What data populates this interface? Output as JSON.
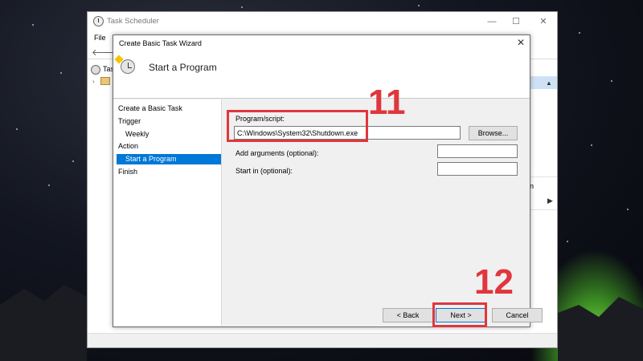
{
  "main_window": {
    "title": "Task Scheduler",
    "menu_file": "File",
    "tree_label": "Tasl",
    "right_pane_fragment": "n",
    "minimize_glyph": "—",
    "maximize_glyph": "☐",
    "close_glyph": "✕"
  },
  "dialog": {
    "title": "Create Basic Task Wizard",
    "header_title": "Start a Program",
    "close_glyph": "✕",
    "nav": [
      {
        "label": "Create a Basic Task"
      },
      {
        "label": "Trigger"
      },
      {
        "label": "Weekly"
      },
      {
        "label": "Action"
      },
      {
        "label": "Start a Program"
      },
      {
        "label": "Finish"
      }
    ],
    "form": {
      "program_label": "Program/script:",
      "program_value": "C:\\Windows\\System32\\Shutdown.exe",
      "browse_label": "Browse...",
      "args_label": "Add arguments (optional):",
      "args_value": "",
      "startin_label": "Start in (optional):",
      "startin_value": ""
    },
    "buttons": {
      "back": "< Back",
      "next": "Next >",
      "cancel": "Cancel"
    }
  },
  "annotations": {
    "step_11": "11",
    "step_12": "12",
    "color": "#e0363d"
  },
  "colors": {
    "selection": "#0078d7",
    "dialog_bg": "#f0f0f0"
  }
}
